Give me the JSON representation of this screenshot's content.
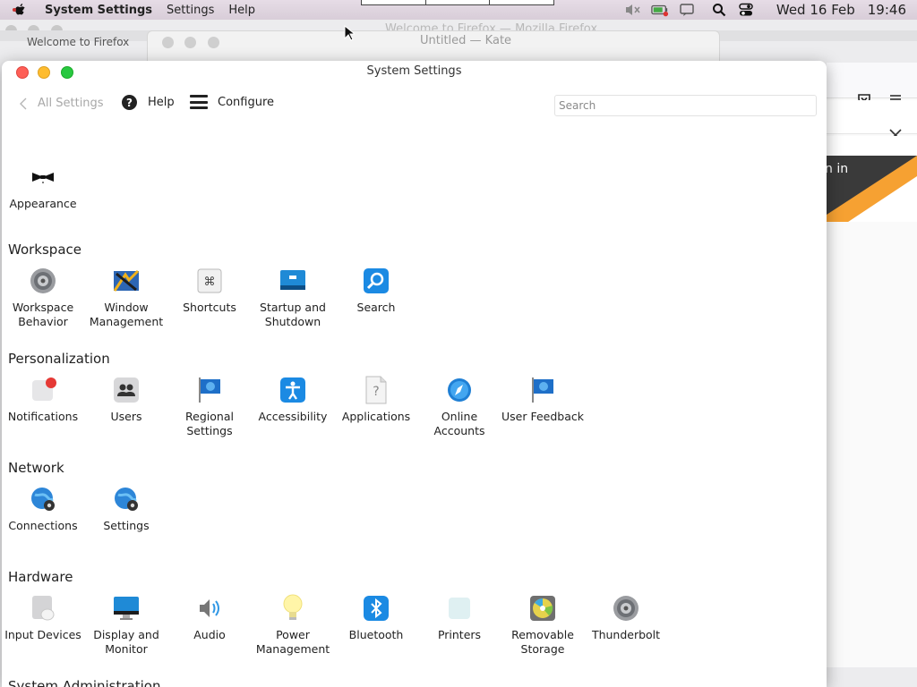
{
  "menubar": {
    "app_name": "System Settings",
    "menus": [
      "Settings",
      "Help"
    ],
    "date": "Wed 16 Feb",
    "time": "19:46"
  },
  "background": {
    "firefox_title": "Welcome to Firefox — Mozilla Firefox",
    "firefox_tab": "Welcome to Firefox",
    "firefox_hero_text": "n in",
    "kate_title": "Untitled — Kate"
  },
  "window": {
    "title": "System Settings",
    "toolbar": {
      "back_label": "All Settings",
      "help_label": "Help",
      "configure_label": "Configure",
      "search_placeholder": "Search"
    }
  },
  "sections": {
    "top": {
      "items": [
        {
          "label": "Appearance",
          "icon": "appearance-bowtie-icon"
        }
      ]
    },
    "workspace": {
      "title": "Workspace",
      "items": [
        {
          "label": "Workspace Behavior",
          "icon": "workspace-behavior-icon"
        },
        {
          "label": "Window Management",
          "icon": "window-management-icon"
        },
        {
          "label": "Shortcuts",
          "icon": "shortcuts-icon"
        },
        {
          "label": "Startup and Shutdown",
          "icon": "startup-shutdown-icon"
        },
        {
          "label": "Search",
          "icon": "search-magnifier-icon"
        }
      ]
    },
    "personalization": {
      "title": "Personalization",
      "items": [
        {
          "label": "Notifications",
          "icon": "notifications-icon"
        },
        {
          "label": "Users",
          "icon": "users-icon"
        },
        {
          "label": "Regional Settings",
          "icon": "regional-flag-icon"
        },
        {
          "label": "Accessibility",
          "icon": "accessibility-icon"
        },
        {
          "label": "Applications",
          "icon": "applications-icon"
        },
        {
          "label": "Online Accounts",
          "icon": "online-accounts-icon"
        },
        {
          "label": "User Feedback",
          "icon": "user-feedback-flag-icon"
        }
      ]
    },
    "network": {
      "title": "Network",
      "items": [
        {
          "label": "Connections",
          "icon": "connections-globe-icon"
        },
        {
          "label": "Settings",
          "icon": "network-settings-globe-icon"
        }
      ]
    },
    "hardware": {
      "title": "Hardware",
      "items": [
        {
          "label": "Input Devices",
          "icon": "input-devices-icon"
        },
        {
          "label": "Display and Monitor",
          "icon": "display-monitor-icon"
        },
        {
          "label": "Audio",
          "icon": "speaker-icon"
        },
        {
          "label": "Power Management",
          "icon": "lightbulb-icon"
        },
        {
          "label": "Bluetooth",
          "icon": "bluetooth-icon"
        },
        {
          "label": "Printers",
          "icon": "printer-icon"
        },
        {
          "label": "Removable Storage",
          "icon": "removable-storage-icon"
        },
        {
          "label": "Thunderbolt",
          "icon": "thunderbolt-icon"
        }
      ]
    },
    "next_partial": {
      "title": "System Administration"
    }
  }
}
